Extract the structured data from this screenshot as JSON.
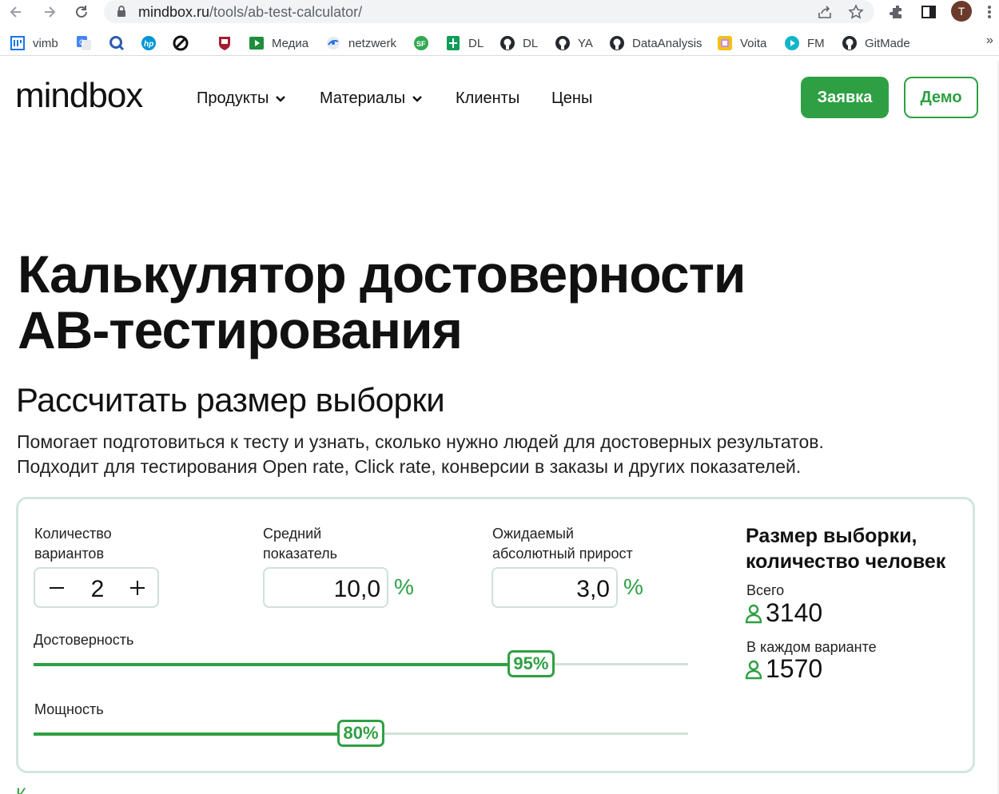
{
  "browser": {
    "url_host": "mindbox.ru",
    "url_path": "/tools/ab-test-calculator/",
    "profile_initial": "T",
    "icons": [
      "back-icon",
      "forward-icon",
      "reload-icon",
      "lock-icon",
      "share-icon",
      "star-icon",
      "extensions-icon",
      "sidepanel-icon",
      "menu-icon"
    ],
    "bookmarks": [
      {
        "label": "vimb",
        "icon": "vimb-icon"
      },
      {
        "label": "",
        "icon": "translate-icon"
      },
      {
        "label": "",
        "icon": "q-icon"
      },
      {
        "label": "",
        "icon": "hp-icon"
      },
      {
        "label": "",
        "icon": "no-sign-icon"
      },
      {
        "label": "",
        "icon": "harvard-icon"
      },
      {
        "label": "Медиа",
        "icon": "media-icon"
      },
      {
        "label": "netzwerk",
        "icon": "netzwerk-icon"
      },
      {
        "label": "",
        "icon": "sf-icon"
      },
      {
        "label": "DL",
        "icon": "sheets-icon"
      },
      {
        "label": "DL",
        "icon": "github-icon"
      },
      {
        "label": "YA",
        "icon": "github-icon"
      },
      {
        "label": "DataAnalysis",
        "icon": "github-icon"
      },
      {
        "label": "Voita",
        "icon": "voita-icon"
      },
      {
        "label": "FM",
        "icon": "play-icon"
      },
      {
        "label": "GitMade",
        "icon": "github-icon"
      }
    ],
    "more": "»"
  },
  "header": {
    "logo": "mindbox",
    "menu": [
      "Продукты",
      "Материалы",
      "Клиенты",
      "Цены"
    ],
    "cta_primary": "Заявка",
    "cta_secondary": "Демо"
  },
  "hero": {
    "title_line1": "Калькулятор достоверности",
    "title_line2": "АВ-тестирования",
    "subtitle": "Рассчитать размер выборки",
    "desc_line1": "Помогает подготовиться к тесту и узнать, сколько нужно людей для достоверных результатов.",
    "desc_line2": "Подходит для тестирования Open rate, Click rate, конверсии в заказы и других показателей."
  },
  "calculator": {
    "variants": {
      "label_line1": "Количество",
      "label_line2": "вариантов",
      "value": "2",
      "minus": "−",
      "plus": "+"
    },
    "average": {
      "label_line1": "Средний",
      "label_line2": "показатель",
      "value": "10,0",
      "unit": "%"
    },
    "uplift": {
      "label_line1": "Ожидаемый",
      "label_line2": "абсолютный прирост",
      "value": "3,0",
      "unit": "%"
    },
    "confidence": {
      "label": "Достоверность",
      "value_text": "95%",
      "level": 0.76
    },
    "power": {
      "label": "Мощность",
      "value_text": "80%",
      "level": 0.5
    },
    "result": {
      "title_line1": "Размер выборки,",
      "title_line2": "количество человек",
      "total_label": "Всего",
      "total_value": "3140",
      "per_variant_label": "В каждом варианте",
      "per_variant_value": "1570"
    }
  },
  "colors": {
    "accent": "#2ea043",
    "border": "#d3e6dd",
    "track": "#cfe1d8"
  },
  "below_fold_text": "К"
}
